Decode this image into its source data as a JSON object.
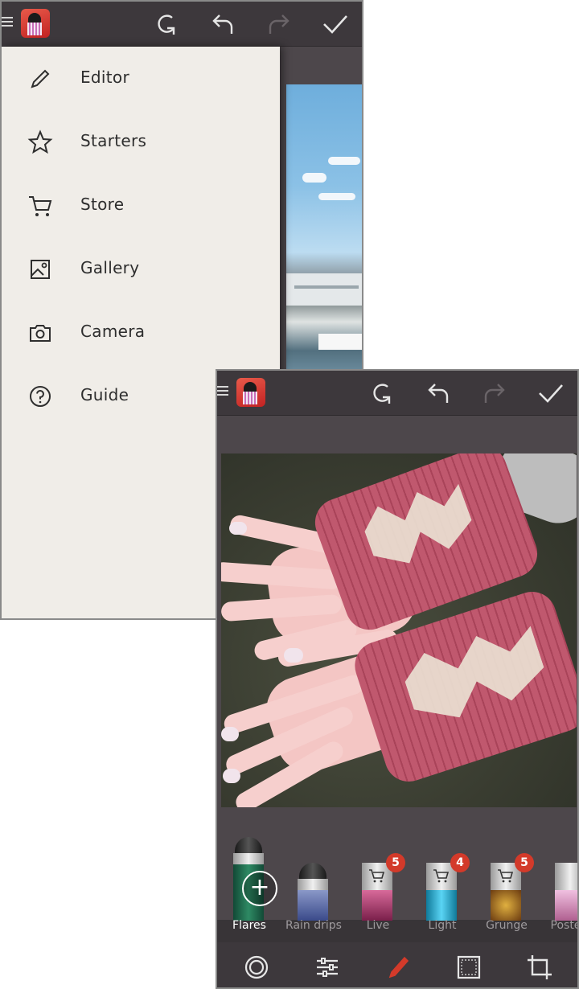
{
  "drawer": {
    "items": [
      {
        "label": "Editor",
        "icon": "pencil-icon"
      },
      {
        "label": "Starters",
        "icon": "star-icon"
      },
      {
        "label": "Store",
        "icon": "cart-icon"
      },
      {
        "label": "Gallery",
        "icon": "gallery-icon"
      },
      {
        "label": "Camera",
        "icon": "camera-icon"
      },
      {
        "label": "Guide",
        "icon": "help-icon"
      }
    ]
  },
  "toolbar": {
    "icons": [
      "menu-icon",
      "app-logo-icon",
      "reset-icon",
      "undo-icon",
      "redo-icon",
      "check-icon"
    ]
  },
  "filters": {
    "items": [
      {
        "label": "Flares",
        "selected": true,
        "badge": "",
        "tube_color": "#1f6a4f"
      },
      {
        "label": "Rain drips",
        "selected": false,
        "badge": "",
        "tube_color": "#4a5a9a"
      },
      {
        "label": "Live",
        "selected": false,
        "badge": "5",
        "tube_color": "#a5336a"
      },
      {
        "label": "Light",
        "selected": false,
        "badge": "4",
        "tube_color": "#2ab0d8"
      },
      {
        "label": "Grunge",
        "selected": false,
        "badge": "5",
        "tube_color": "#a57320"
      },
      {
        "label": "Posters",
        "selected": false,
        "badge": "",
        "tube_color": "#d8a0c8"
      }
    ]
  },
  "bottom_toolbar": {
    "icons": [
      "vignette-icon",
      "adjust-icon",
      "brush-icon",
      "frame-icon",
      "crop-icon"
    ],
    "accent": "#d33a2a"
  },
  "colors": {
    "topbar": "#3d383c",
    "background": "#4d474b",
    "drawer": "#f0ede8",
    "badge": "#d33a2a"
  }
}
